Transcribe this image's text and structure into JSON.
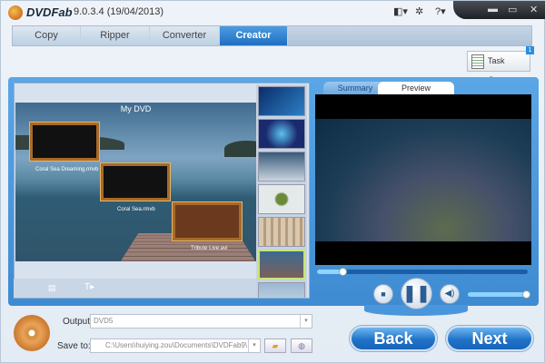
{
  "app": {
    "brand": "DVDFab",
    "version": "9.0.3.4 (19/04/2013)"
  },
  "titlebar_icons": [
    "layout-icon",
    "gear-icon",
    "help-icon"
  ],
  "window_controls": [
    "minimize",
    "maximize",
    "close"
  ],
  "tabs": [
    {
      "label": "Copy"
    },
    {
      "label": "Ripper"
    },
    {
      "label": "Converter"
    },
    {
      "label": "Creator",
      "active": true
    }
  ],
  "task_queue": {
    "label": "Task Queue",
    "badge": "1"
  },
  "menu_preview": {
    "title": "My DVD",
    "chapters": [
      {
        "label": "Coral Sea Dreaming.rmvb"
      },
      {
        "label": "Coral Sea.rmvb"
      },
      {
        "label": "Tribute Live.avi"
      }
    ],
    "templates_count_visible": 7,
    "selected_template": 6
  },
  "preview": {
    "tabs": [
      {
        "label": "Summary"
      },
      {
        "label": "Preview",
        "active": true
      }
    ],
    "seek_progress": 0.12,
    "volume": 0.98,
    "state": "playing"
  },
  "output": {
    "label": "Output:",
    "value": "DVD5"
  },
  "save_to": {
    "label": "Save to:",
    "value": "C:\\Users\\huiying.zou\\Documents\\DVDFab9\\"
  },
  "buttons": {
    "back": "Back",
    "next": "Next"
  },
  "colors": {
    "accent": "#2073c8",
    "active_tab": "#2f80d0",
    "panel": "#4a96dc"
  }
}
